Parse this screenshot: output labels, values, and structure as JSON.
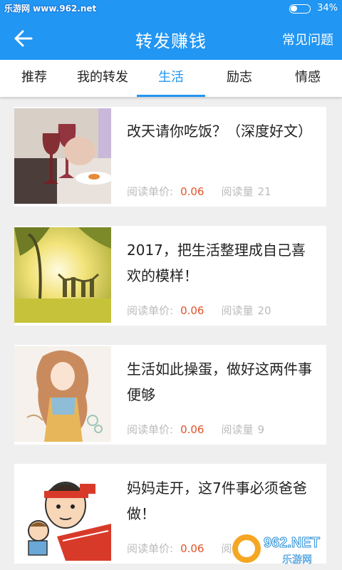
{
  "status_bar": {
    "left_text": "乐游网 www.962.net",
    "battery_percent": "34%",
    "battery_level": 0.34
  },
  "app_bar": {
    "title": "转发赚钱",
    "action_label": "常见问题"
  },
  "tabs": [
    {
      "label": "推荐",
      "active": false
    },
    {
      "label": "我的转发",
      "active": false
    },
    {
      "label": "生活",
      "active": true
    },
    {
      "label": "励志",
      "active": false
    },
    {
      "label": "情感",
      "active": false
    }
  ],
  "articles": [
    {
      "title": "改天请你吃饭？（深度好文）",
      "price_label": "阅读单价:",
      "price": "0.06",
      "read_label": "阅读量",
      "read_count": "21",
      "thumb": "wine-glasses-photo"
    },
    {
      "title": "2017，把生活整理成自己喜欢的模样！",
      "price_label": "阅读单价:",
      "price": "0.06",
      "read_label": "阅读量",
      "read_count": "20",
      "thumb": "sunset-people-photo"
    },
    {
      "title": "生活如此操蛋，做好这两件事便够",
      "price_label": "阅读单价:",
      "price": "0.06",
      "read_label": "阅读量",
      "read_count": "9",
      "thumb": "girl-illustration"
    },
    {
      "title": "妈妈走开，这7件事必须爸爸做！",
      "price_label": "阅读单价:",
      "price": "0.06",
      "read_label": "阅读量",
      "read_count": "",
      "thumb": "cartoon-dad-illustration"
    }
  ],
  "watermark": {
    "logo_text": "962.NET",
    "sub_text": "乐游网"
  },
  "colors": {
    "primary": "#2196f3",
    "price": "#e2542a",
    "muted": "#bbbbbb"
  }
}
